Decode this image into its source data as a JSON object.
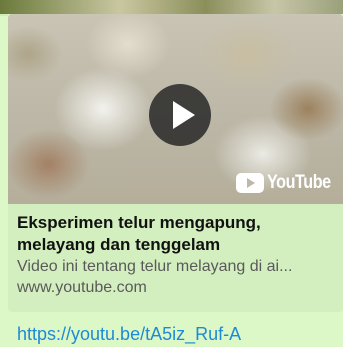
{
  "preview": {
    "title": "Eksperimen telur mengapung, melayang dan tenggelam",
    "description": "Video ini tentang telur melayang di ai...",
    "domain": "www.youtube.com",
    "logo_text": "YouTube"
  },
  "message": {
    "link_text": "https://youtu.be/tA5iz_Ruf-A"
  },
  "colors": {
    "bubble": "#dcf8c6",
    "link": "#1e8ad6"
  },
  "icons": {
    "play": "play-icon",
    "youtube": "youtube-logo-icon"
  }
}
